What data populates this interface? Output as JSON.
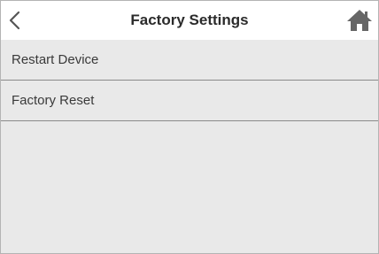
{
  "header": {
    "title": "Factory Settings",
    "back_icon": "chevron-left-icon",
    "home_icon": "home-icon"
  },
  "menu": {
    "items": [
      {
        "label": "Restart Device"
      },
      {
        "label": "Factory Reset"
      }
    ]
  },
  "colors": {
    "header_bg": "#ffffff",
    "list_bg": "#e9e9e9",
    "divider": "#8a8a8a",
    "icon": "#666666"
  }
}
